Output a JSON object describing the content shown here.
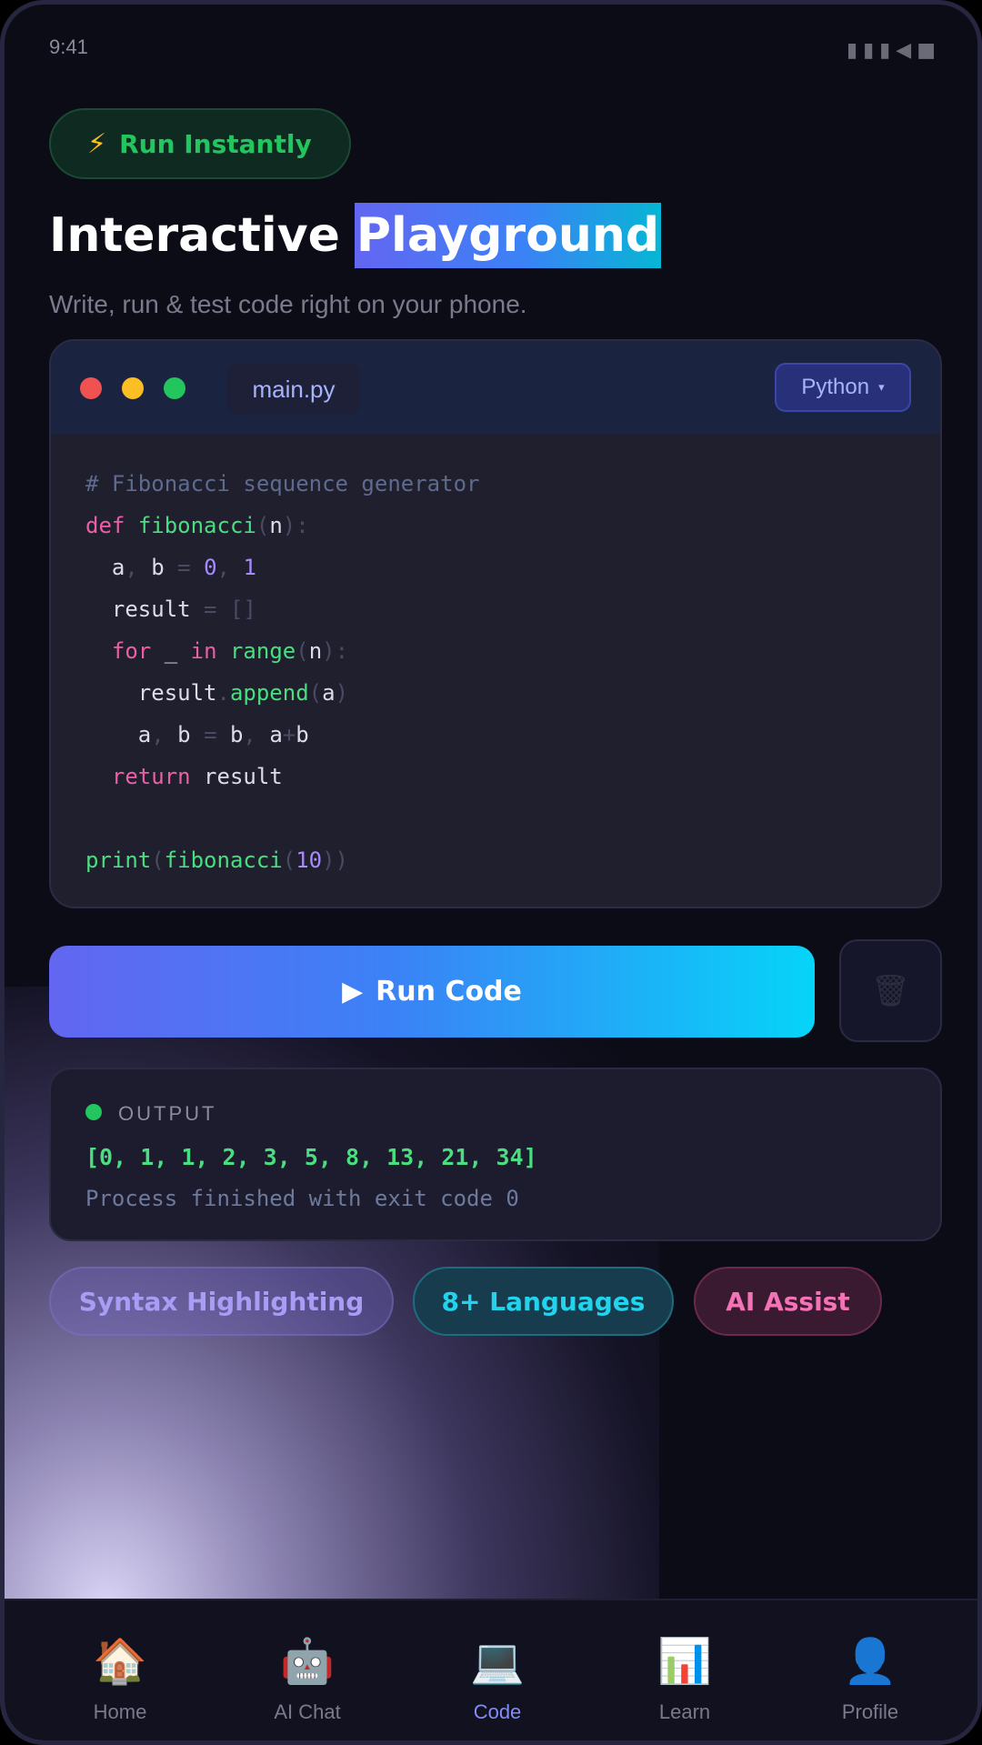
{
  "status_bar": {
    "time": "9:41",
    "icons": "▮▮▮◀■"
  },
  "badge": {
    "icon": "⚡",
    "text": "Run Instantly"
  },
  "headline": {
    "white": "Interactive",
    "highlight": "Playground"
  },
  "subtitle": "Write, run & test code right on your phone.",
  "editor": {
    "file_name": "main.py",
    "language": "Python",
    "language_caret": "▾",
    "code_lines": [
      [
        {
          "t": "cm",
          "v": "# Fibonacci sequence generator"
        }
      ],
      [
        {
          "t": "kw",
          "v": "def"
        },
        {
          "t": "id",
          "v": " "
        },
        {
          "t": "fn",
          "v": "fibonacci"
        },
        {
          "t": "p",
          "v": "("
        },
        {
          "t": "id",
          "v": "n"
        },
        {
          "t": "p",
          "v": "):"
        }
      ],
      [
        {
          "t": "id",
          "v": "  a"
        },
        {
          "t": "p",
          "v": ","
        },
        {
          "t": "id",
          "v": " b "
        },
        {
          "t": "p",
          "v": "="
        },
        {
          "t": "id",
          "v": " "
        },
        {
          "t": "num",
          "v": "0"
        },
        {
          "t": "p",
          "v": ","
        },
        {
          "t": "id",
          "v": " "
        },
        {
          "t": "num",
          "v": "1"
        }
      ],
      [
        {
          "t": "id",
          "v": "  result "
        },
        {
          "t": "p",
          "v": "= []"
        }
      ],
      [
        {
          "t": "id",
          "v": "  "
        },
        {
          "t": "kw",
          "v": "for"
        },
        {
          "t": "id",
          "v": " _ "
        },
        {
          "t": "kw",
          "v": "in"
        },
        {
          "t": "id",
          "v": " "
        },
        {
          "t": "fn",
          "v": "range"
        },
        {
          "t": "p",
          "v": "("
        },
        {
          "t": "id",
          "v": "n"
        },
        {
          "t": "p",
          "v": "):"
        }
      ],
      [
        {
          "t": "id",
          "v": "    result"
        },
        {
          "t": "p",
          "v": "."
        },
        {
          "t": "fn",
          "v": "append"
        },
        {
          "t": "p",
          "v": "("
        },
        {
          "t": "id",
          "v": "a"
        },
        {
          "t": "p",
          "v": ")"
        }
      ],
      [
        {
          "t": "id",
          "v": "    a"
        },
        {
          "t": "p",
          "v": ","
        },
        {
          "t": "id",
          "v": " b "
        },
        {
          "t": "p",
          "v": "="
        },
        {
          "t": "id",
          "v": " b"
        },
        {
          "t": "p",
          "v": ","
        },
        {
          "t": "id",
          "v": " a"
        },
        {
          "t": "p",
          "v": "+"
        },
        {
          "t": "id",
          "v": "b"
        }
      ],
      [
        {
          "t": "id",
          "v": "  "
        },
        {
          "t": "kw",
          "v": "return"
        },
        {
          "t": "id",
          "v": " result"
        }
      ],
      [],
      [
        {
          "t": "fn",
          "v": "print"
        },
        {
          "t": "p",
          "v": "("
        },
        {
          "t": "fn",
          "v": "fibonacci"
        },
        {
          "t": "p",
          "v": "("
        },
        {
          "t": "num",
          "v": "10"
        },
        {
          "t": "p",
          "v": "))"
        }
      ]
    ]
  },
  "actions": {
    "run_icon": "▶",
    "run_label": "Run Code",
    "trash_icon": "🗑"
  },
  "output": {
    "label": "OUTPUT",
    "result": "[0, 1, 1, 2, 3, 5, 8, 13, 21, 34]",
    "status": "Process finished with exit code 0"
  },
  "chips": [
    "Syntax Highlighting",
    "8+ Languages",
    "AI Assist"
  ],
  "nav": [
    {
      "icon": "🏠",
      "label": "Home",
      "active": false
    },
    {
      "icon": "🤖",
      "label": "AI Chat",
      "active": false
    },
    {
      "icon": "💻",
      "label": "Code",
      "active": true
    },
    {
      "icon": "📊",
      "label": "Learn",
      "active": false
    },
    {
      "icon": "👤",
      "label": "Profile",
      "active": false
    }
  ],
  "colors": {
    "background": "#0c0c17",
    "accent_green": "#22c55e",
    "accent_indigo": "#6366f1",
    "accent_cyan": "#06d4f8",
    "accent_pink": "#f472b6"
  }
}
